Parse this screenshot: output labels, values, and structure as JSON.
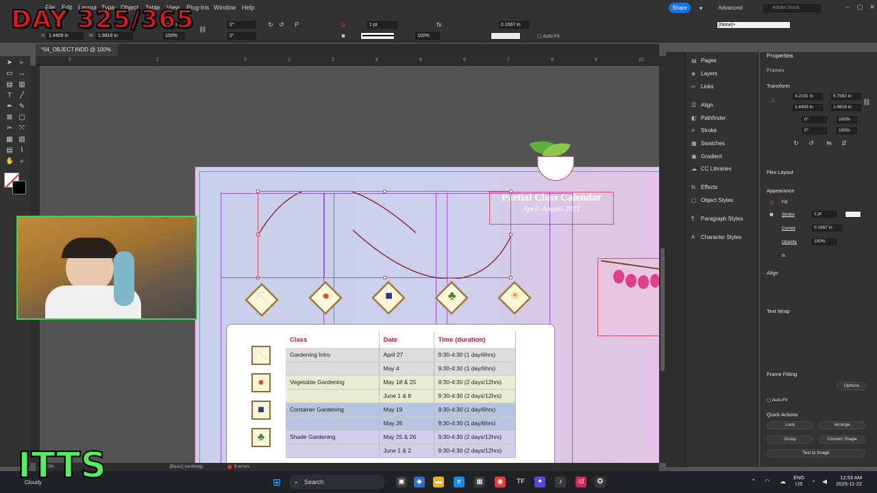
{
  "menubar": {
    "items": [
      "File",
      "Edit",
      "Layout",
      "Type",
      "Object",
      "Table",
      "View",
      "Plug-Ins",
      "Window",
      "Help"
    ],
    "share_label": "Share",
    "workspace": "Advanced",
    "search_placeholder": "Adobe Stock"
  },
  "controlbar": {
    "x_value": "4.2191 in",
    "y_value": "1.4409 in",
    "w_value": "5.7582 in",
    "h_value": "1.9818 in",
    "scale_x": "100%",
    "scale_y": "100%",
    "rotate": "0°",
    "shear": "0°",
    "stroke_weight": "1 pt",
    "opacity": "100%",
    "corner": "0.1667 in",
    "autofit_label": "Auto-Fit",
    "style_value": "[None]+"
  },
  "document": {
    "tab_title": "*04_OBJECT.INDD @ 100%",
    "ruler_marks": [
      "3",
      "2",
      "1",
      "0",
      "1",
      "2",
      "3",
      "4",
      "5",
      "6",
      "7",
      "8",
      "9",
      "10"
    ]
  },
  "calendar": {
    "title": "Partial Class Calendar",
    "subtitle": "April–August 2021"
  },
  "table": {
    "headers": [
      "Class",
      "Date",
      "Time (duration)"
    ],
    "rows": [
      {
        "class": "Gardening Intro",
        "date": "April 27",
        "time": "9:30-4:30 (1 day/6hrs)"
      },
      {
        "class": "",
        "date": "May 4",
        "time": "9:30-4:30 (1 day/6hrs)"
      },
      {
        "class": "Vegetable Gardening",
        "date": "May 18 & 25",
        "time": "9:30-4:30 (2 days/12hrs)"
      },
      {
        "class": "",
        "date": "June 1 & 8",
        "time": "9:30-4:30 (2 days/12hrs)"
      },
      {
        "class": "Container Gardening",
        "date": "May 19",
        "time": "9:30-4:30 (1 day/6hrs)"
      },
      {
        "class": "",
        "date": "May 26",
        "time": "9:30-4:30 (1 day/6hrs)"
      },
      {
        "class": "Shade Gardening",
        "date": "May 25 & 26",
        "time": "9:30-4:30 (2 days/12hrs)"
      },
      {
        "class": "",
        "date": "June 1 & 2",
        "time": "9:30-4:30 (2 days/12hrs)"
      }
    ]
  },
  "dock": {
    "items": [
      "Pages",
      "Layers",
      "Links",
      "Align",
      "Pathfinder",
      "Stroke",
      "Swatches",
      "Gradient",
      "CC Libraries",
      "Effects",
      "Object Styles",
      "Paragraph Styles",
      "Character Styles"
    ]
  },
  "properties": {
    "title": "Properties",
    "section_frames": "Frames",
    "section_transform": "Transform",
    "x": "4.2191 in",
    "y": "1.4409 in",
    "w": "5.7582 in",
    "h": "1.9818 in",
    "angle": "0°",
    "shear": "0°",
    "scale_x": "100%",
    "scale_y": "100%",
    "section_flex": "Flex Layout",
    "section_appearance": "Appearance",
    "fill_label": "Fill",
    "stroke_label": "Stroke",
    "stroke_value": "1 pt",
    "corner_label": "Corner",
    "corner_value": "0.1667 in",
    "opacity_label": "Opacity",
    "opacity_value": "100%",
    "fx_label": "fx.",
    "section_align": "Align",
    "section_textwrap": "Text Wrap",
    "section_framefitting": "Frame Fitting",
    "options_label": "Options",
    "autofit_label": "Auto-Fit",
    "section_quick": "Quick Actions",
    "lock_label": "Lock",
    "arrange_label": "Arrange",
    "group_label": "Group",
    "convert_label": "Convert Shape",
    "text_to_image": "Text to Image"
  },
  "statusbar": {
    "zoom": "100%",
    "style": "[Basic] (working)",
    "errors": "6 errors"
  },
  "taskbar": {
    "search_label": "Search",
    "weather": "Cloudy",
    "lang_top": "ENG",
    "lang_bottom": "US",
    "time": "12:53 AM",
    "date": "2025-11-22"
  },
  "overlay": {
    "banner": "DAY 325/365",
    "brand": "ITTS"
  },
  "colors": {
    "accent": "#1473e6",
    "header_red": "#b31e3d",
    "guide": "#9b55e2",
    "selection": "#d44f6b"
  }
}
